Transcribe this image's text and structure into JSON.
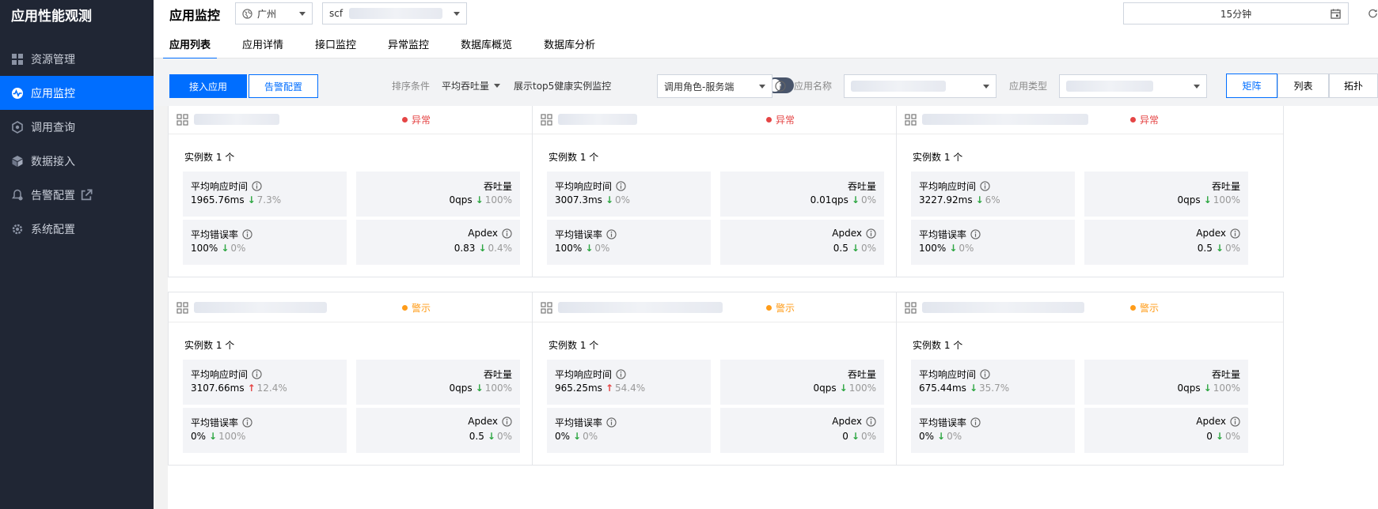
{
  "sidebar": {
    "brand": "应用性能观测",
    "items": [
      {
        "label": "资源管理",
        "icon": "grid-icon"
      },
      {
        "label": "应用监控",
        "icon": "pulse-icon",
        "active": true
      },
      {
        "label": "调用查询",
        "icon": "hexagon-icon"
      },
      {
        "label": "数据接入",
        "icon": "cube-icon"
      },
      {
        "label": "告警配置",
        "icon": "bell-gear-icon",
        "external": true
      },
      {
        "label": "系统配置",
        "icon": "settings-icon"
      }
    ]
  },
  "header": {
    "title": "应用监控",
    "region": "广州",
    "instance_prefix": "scf",
    "time_range": "15分钟",
    "tabs": [
      "应用列表",
      "应用详情",
      "接口监控",
      "异常监控",
      "数据库概览",
      "数据库分析"
    ]
  },
  "toolbar": {
    "connect_app": "接入应用",
    "alarm_config": "告警配置",
    "sort_label": "排序条件",
    "sort_value": "平均吞吐量",
    "top5_label": "展示top5健康实例监控",
    "role_value": "调用角色-服务端",
    "app_name_label": "应用名称",
    "app_type_label": "应用类型",
    "views": [
      "矩阵",
      "列表",
      "拓扑"
    ]
  },
  "colors": {
    "primary": "#006eff",
    "error": "#e54545",
    "warning": "#ff9c19",
    "down": "#2da641"
  },
  "cards": [
    {
      "status": "异常",
      "level": "err",
      "instances": "实例数 1 个",
      "rt_label": "平均响应时间",
      "rt": "1965.76ms",
      "rt_dir": "down",
      "rt_delta": "7.3%",
      "tp_label": "吞吐量",
      "tp": "0qps",
      "tp_dir": "down",
      "tp_delta": "100%",
      "er_label": "平均错误率",
      "er": "100%",
      "er_dir": "down",
      "er_delta": "0%",
      "ap_label": "Apdex",
      "ap": "0.83",
      "ap_dir": "down",
      "ap_delta": "0.4%"
    },
    {
      "status": "异常",
      "level": "err",
      "instances": "实例数 1 个",
      "rt_label": "平均响应时间",
      "rt": "3007.3ms",
      "rt_dir": "down",
      "rt_delta": "0%",
      "tp_label": "吞吐量",
      "tp": "0.01qps",
      "tp_dir": "down",
      "tp_delta": "0%",
      "er_label": "平均错误率",
      "er": "100%",
      "er_dir": "down",
      "er_delta": "0%",
      "ap_label": "Apdex",
      "ap": "0.5",
      "ap_dir": "down",
      "ap_delta": "0%"
    },
    {
      "status": "异常",
      "level": "err",
      "instances": "实例数 1 个",
      "rt_label": "平均响应时间",
      "rt": "3227.92ms",
      "rt_dir": "down",
      "rt_delta": "6%",
      "tp_label": "吞吐量",
      "tp": "0qps",
      "tp_dir": "down",
      "tp_delta": "100%",
      "er_label": "平均错误率",
      "er": "100%",
      "er_dir": "down",
      "er_delta": "0%",
      "ap_label": "Apdex",
      "ap": "0.5",
      "ap_dir": "down",
      "ap_delta": "0%"
    },
    {
      "status": "警示",
      "level": "warn",
      "instances": "实例数 1 个",
      "rt_label": "平均响应时间",
      "rt": "3107.66ms",
      "rt_dir": "up",
      "rt_delta": "12.4%",
      "tp_label": "吞吐量",
      "tp": "0qps",
      "tp_dir": "down",
      "tp_delta": "100%",
      "er_label": "平均错误率",
      "er": "0%",
      "er_dir": "down",
      "er_delta": "100%",
      "ap_label": "Apdex",
      "ap": "0.5",
      "ap_dir": "down",
      "ap_delta": "0%"
    },
    {
      "status": "警示",
      "level": "warn",
      "instances": "实例数 1 个",
      "rt_label": "平均响应时间",
      "rt": "965.25ms",
      "rt_dir": "up",
      "rt_delta": "54.4%",
      "tp_label": "吞吐量",
      "tp": "0qps",
      "tp_dir": "down",
      "tp_delta": "100%",
      "er_label": "平均错误率",
      "er": "0%",
      "er_dir": "down",
      "er_delta": "0%",
      "ap_label": "Apdex",
      "ap": "0",
      "ap_dir": "down",
      "ap_delta": "0%"
    },
    {
      "status": "警示",
      "level": "warn",
      "instances": "实例数 1 个",
      "rt_label": "平均响应时间",
      "rt": "675.44ms",
      "rt_dir": "down",
      "rt_delta": "35.7%",
      "tp_label": "吞吐量",
      "tp": "0qps",
      "tp_dir": "down",
      "tp_delta": "100%",
      "er_label": "平均错误率",
      "er": "0%",
      "er_dir": "down",
      "er_delta": "0%",
      "ap_label": "Apdex",
      "ap": "0",
      "ap_dir": "down",
      "ap_delta": "0%"
    }
  ]
}
